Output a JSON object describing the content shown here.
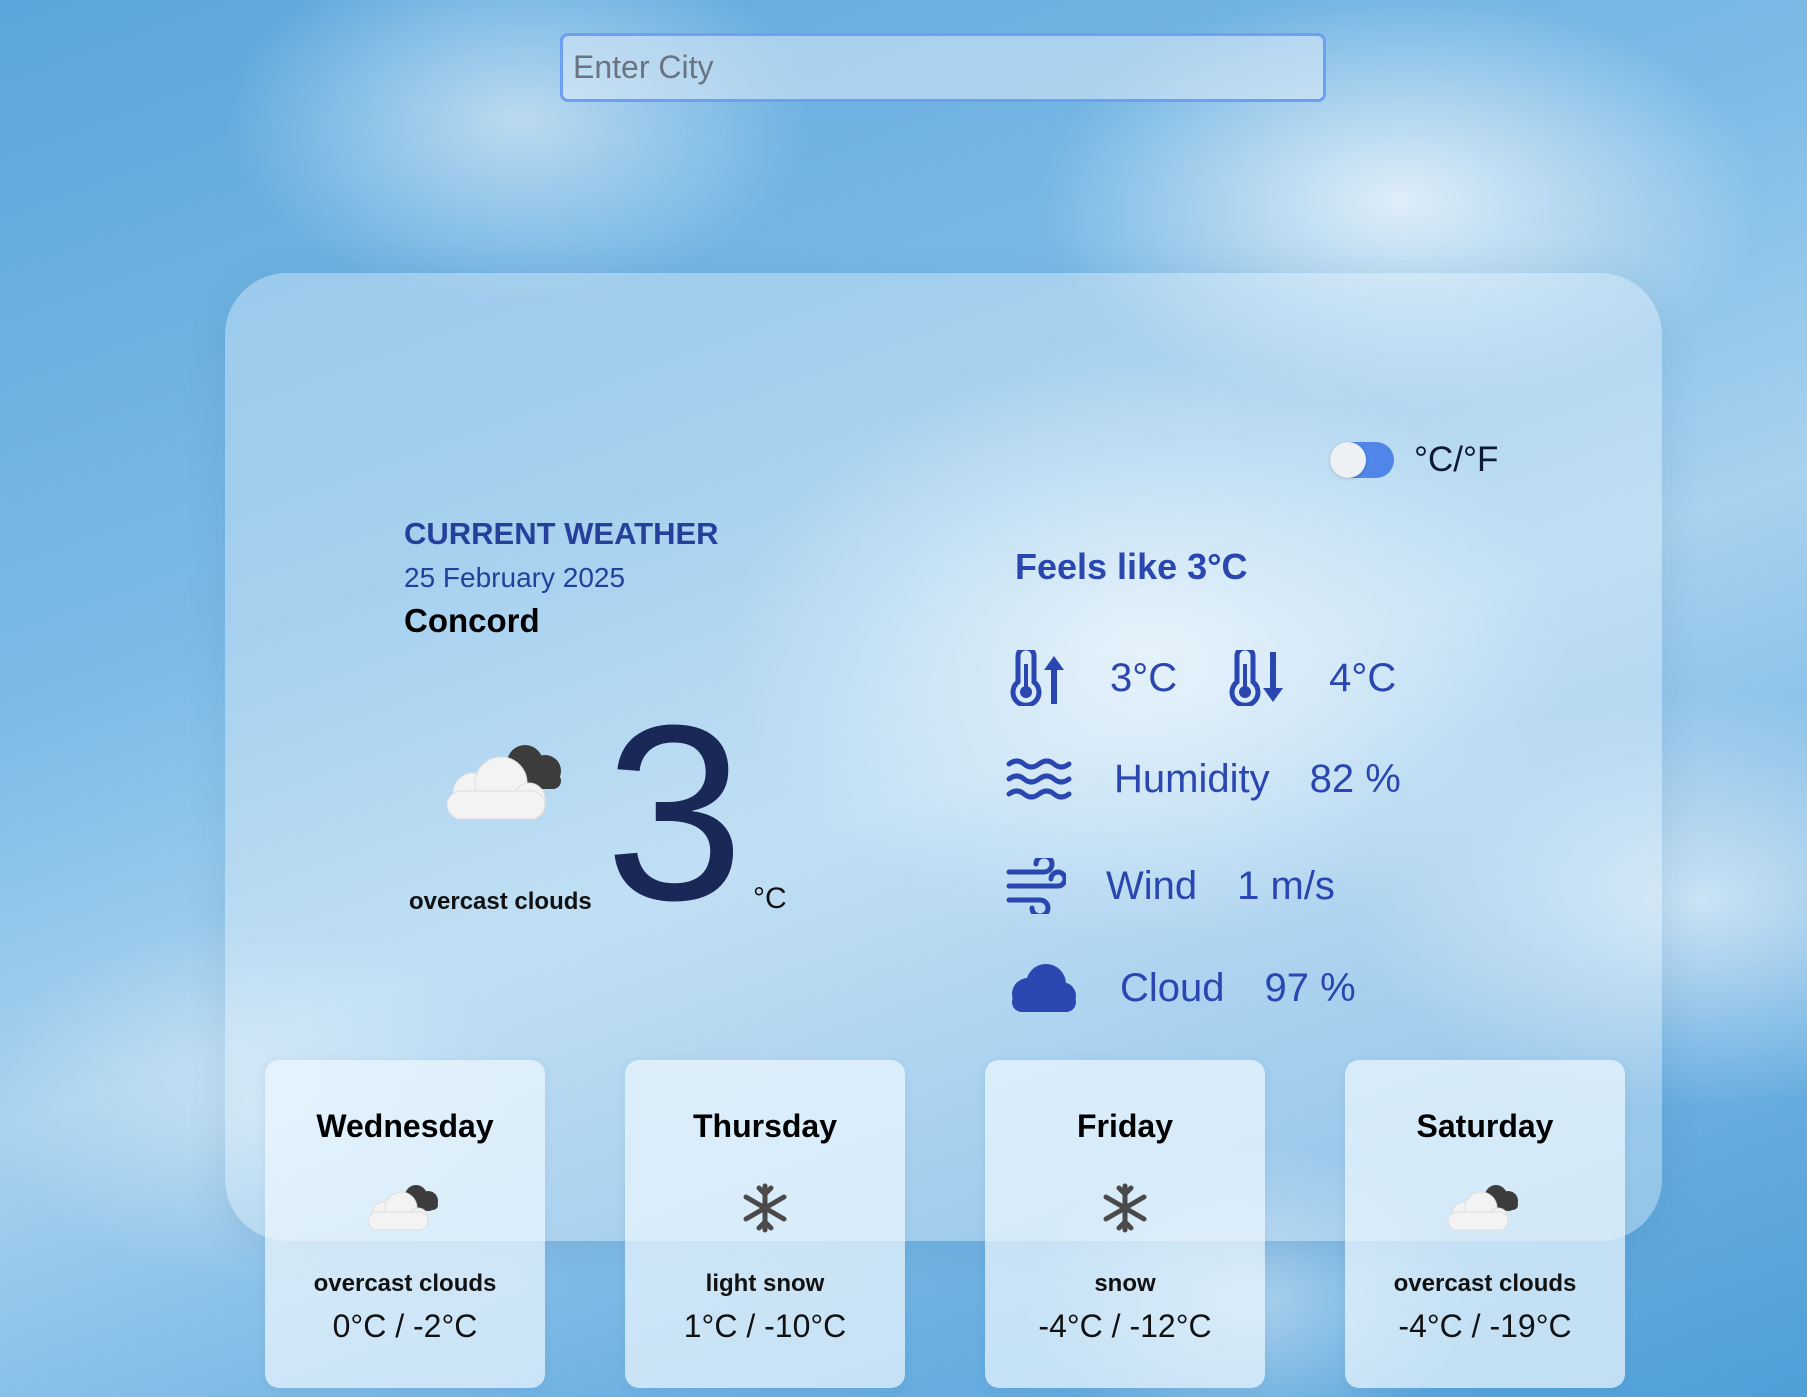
{
  "search": {
    "placeholder": "Enter City",
    "value": ""
  },
  "unit_toggle": {
    "label": "°C/°F",
    "state": "celsius"
  },
  "current": {
    "section_title": "CURRENT WEATHER",
    "date": "25 February 2025",
    "city": "Concord",
    "icon": "overcast-clouds-icon",
    "description": "overcast clouds",
    "temperature": "3",
    "unit": "°C",
    "feels_like": "Feels like 3°C",
    "temp_max": "3°C",
    "temp_min": "4°C",
    "humidity_label": "Humidity",
    "humidity_value": "82 %",
    "wind_label": "Wind",
    "wind_value": "1 m/s",
    "cloud_label": "Cloud",
    "cloud_value": "97 %"
  },
  "forecast": [
    {
      "day": "Wednesday",
      "icon": "overcast-clouds-icon",
      "description": "overcast clouds",
      "temps": "0°C / -2°C"
    },
    {
      "day": "Thursday",
      "icon": "snowflake-icon",
      "description": "light snow",
      "temps": "1°C / -10°C"
    },
    {
      "day": "Friday",
      "icon": "snowflake-icon",
      "description": "snow",
      "temps": "-4°C / -12°C"
    },
    {
      "day": "Saturday",
      "icon": "overcast-clouds-icon",
      "description": "overcast clouds",
      "temps": "-4°C / -19°C"
    }
  ],
  "colors": {
    "accent": "#2a46b0",
    "toggle": "#4f86e8",
    "big_temp": "#1a2857",
    "input_border": "#6f9ff0"
  }
}
